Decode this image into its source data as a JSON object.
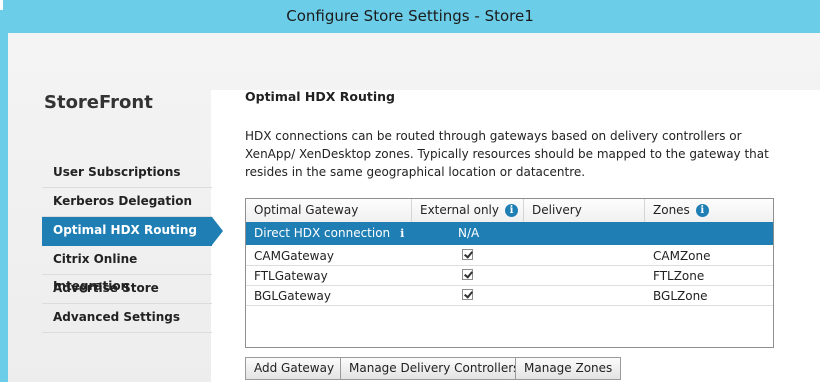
{
  "window": {
    "title": "Configure Store Settings - Store1"
  },
  "sidebar": {
    "brand": "StoreFront",
    "items": [
      {
        "label": "User Subscriptions"
      },
      {
        "label": "Kerberos Delegation"
      },
      {
        "label": "Optimal HDX Routing",
        "active": true
      },
      {
        "label": "Citrix Online Integration"
      },
      {
        "label": "Advertise Store"
      },
      {
        "label": "Advanced Settings"
      }
    ]
  },
  "main": {
    "title": "Optimal HDX Routing",
    "description": "HDX connections can be routed through gateways based on delivery controllers or XenApp/ XenDesktop zones. Typically resources should be mapped to the gateway that resides in the same geographical location or datacentre.",
    "table": {
      "columns": [
        "Optimal Gateway",
        "External only",
        "Delivery Controllers",
        "Zones"
      ],
      "direct_row": {
        "gateway": "Direct HDX connection",
        "external_only": "N/A"
      },
      "rows": [
        {
          "gateway": "CAMGateway",
          "external_only": true,
          "delivery_controllers": "",
          "zones": "CAMZone"
        },
        {
          "gateway": "FTLGateway",
          "external_only": true,
          "delivery_controllers": "",
          "zones": "FTLZone"
        },
        {
          "gateway": "BGLGateway",
          "external_only": true,
          "delivery_controllers": "",
          "zones": "BGLZone"
        }
      ]
    },
    "buttons": {
      "add_gateway": "Add Gateway",
      "manage_delivery_controllers": "Manage Delivery Controllers",
      "manage_zones": "Manage Zones"
    }
  },
  "colors": {
    "titlebar": "#6ccde9",
    "accent": "#1f7fb5"
  },
  "icons": {
    "info": "info-icon",
    "check": "checkbox-checked"
  }
}
